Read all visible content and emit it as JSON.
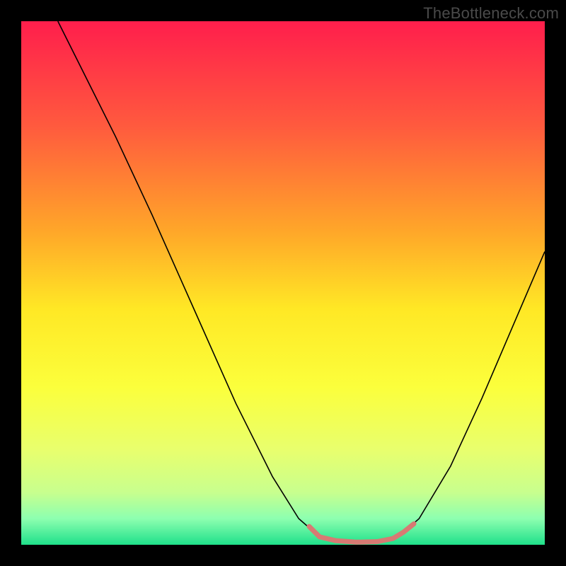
{
  "watermark": "TheBottleneck.com",
  "chart_data": {
    "type": "line",
    "title": "",
    "xlabel": "",
    "ylabel": "",
    "xlim": [
      0,
      100
    ],
    "ylim": [
      0,
      100
    ],
    "grid": false,
    "legend": false,
    "background_gradient": {
      "stops": [
        {
          "offset": 0.0,
          "color": "#ff1e4c"
        },
        {
          "offset": 0.2,
          "color": "#ff5a3e"
        },
        {
          "offset": 0.4,
          "color": "#ffa629"
        },
        {
          "offset": 0.55,
          "color": "#ffe825"
        },
        {
          "offset": 0.7,
          "color": "#fbff3c"
        },
        {
          "offset": 0.82,
          "color": "#e8ff6e"
        },
        {
          "offset": 0.9,
          "color": "#c8ff8e"
        },
        {
          "offset": 0.95,
          "color": "#8dffb0"
        },
        {
          "offset": 1.0,
          "color": "#1fe08a"
        }
      ]
    },
    "series": [
      {
        "name": "curve",
        "color": "#000000",
        "width": 1.6,
        "points": [
          {
            "x": 7,
            "y": 100
          },
          {
            "x": 12,
            "y": 90
          },
          {
            "x": 18,
            "y": 78
          },
          {
            "x": 25,
            "y": 63
          },
          {
            "x": 33,
            "y": 45
          },
          {
            "x": 41,
            "y": 27
          },
          {
            "x": 48,
            "y": 13
          },
          {
            "x": 53,
            "y": 5
          },
          {
            "x": 57,
            "y": 1.5
          },
          {
            "x": 62,
            "y": 0.5
          },
          {
            "x": 67,
            "y": 0.5
          },
          {
            "x": 72,
            "y": 1.5
          },
          {
            "x": 76,
            "y": 5
          },
          {
            "x": 82,
            "y": 15
          },
          {
            "x": 88,
            "y": 28
          },
          {
            "x": 94,
            "y": 42
          },
          {
            "x": 100,
            "y": 56
          }
        ]
      },
      {
        "name": "bottom-marker",
        "color": "#d77a73",
        "width": 7,
        "linecap": "round",
        "points": [
          {
            "x": 55,
            "y": 3.5
          },
          {
            "x": 57,
            "y": 1.5
          },
          {
            "x": 60,
            "y": 0.8
          },
          {
            "x": 64,
            "y": 0.5
          },
          {
            "x": 68,
            "y": 0.6
          },
          {
            "x": 71,
            "y": 1.2
          },
          {
            "x": 73,
            "y": 2.4
          },
          {
            "x": 75,
            "y": 4.0
          }
        ]
      }
    ]
  }
}
